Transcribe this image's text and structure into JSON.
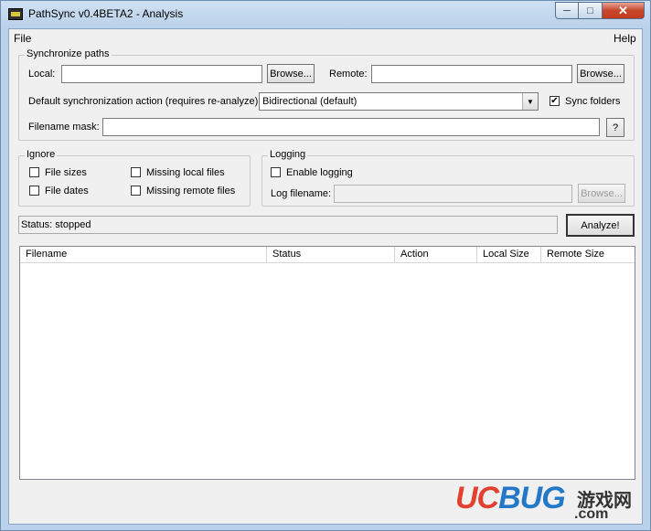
{
  "window": {
    "title": "PathSync v0.4BETA2 - Analysis"
  },
  "menu": {
    "file": "File",
    "help": "Help"
  },
  "sync": {
    "group_title": "Synchronize paths",
    "local_label": "Local:",
    "local_value": "",
    "local_browse": "Browse...",
    "remote_label": "Remote:",
    "remote_value": "",
    "remote_browse": "Browse...",
    "action_label": "Default synchronization action (requires re-analyze):",
    "action_selected": "Bidirectional (default)",
    "sync_folders_label": "Sync folders",
    "sync_folders_checked": "✔",
    "mask_label": "Filename mask:",
    "mask_value": "",
    "mask_help": "?"
  },
  "ignore": {
    "group_title": "Ignore",
    "file_sizes": "File sizes",
    "file_dates": "File dates",
    "missing_local": "Missing local files",
    "missing_remote": "Missing remote files"
  },
  "logging": {
    "group_title": "Logging",
    "enable_label": "Enable logging",
    "log_filename_label": "Log filename:",
    "log_filename_value": "",
    "browse": "Browse..."
  },
  "status": {
    "text": "Status: stopped",
    "analyze": "Analyze!"
  },
  "table": {
    "columns": [
      "Filename",
      "Status",
      "Action",
      "Local Size",
      "Remote Size"
    ]
  },
  "watermark": {
    "uc": "UC",
    "bug": "BUG",
    "cn": "游戏网",
    "com": ".com"
  },
  "colors": {
    "watermark_red": "#e2412f",
    "watermark_blue": "#2478c8",
    "titlebar": "#b9d1ea"
  }
}
